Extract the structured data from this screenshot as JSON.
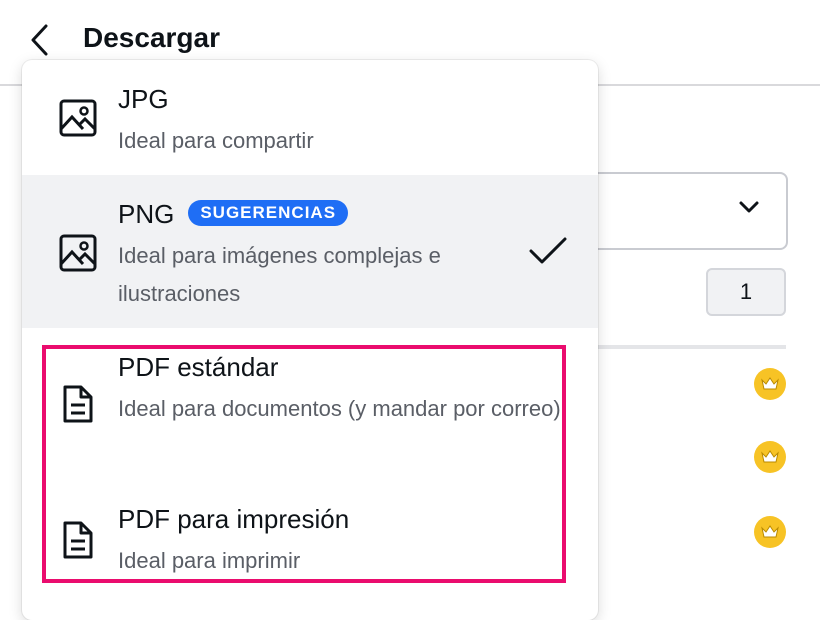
{
  "header": {
    "back_icon": "chevron-left-icon",
    "title": "Descargar"
  },
  "background": {
    "quantity_value": "1",
    "crown_icon": "crown-icon",
    "crown_color": "#f7c325"
  },
  "formats": [
    {
      "icon": "image-icon",
      "title": "JPG",
      "description": "Ideal para compartir",
      "selected": false
    },
    {
      "icon": "image-icon",
      "title": "PNG",
      "badge": "SUGERENCIAS",
      "description": "Ideal para imágenes complejas e ilustraciones",
      "selected": true
    },
    {
      "icon": "document-icon",
      "title": "PDF estándar",
      "description": "Ideal para documentos (y mandar por correo)",
      "selected": false
    },
    {
      "icon": "document-icon",
      "title": "PDF para impresión",
      "description": "Ideal para imprimir",
      "selected": false
    }
  ],
  "colors": {
    "accent": "#1f6ef5",
    "highlight": "#ea0c6e",
    "selected_bg": "#f1f2f4"
  }
}
